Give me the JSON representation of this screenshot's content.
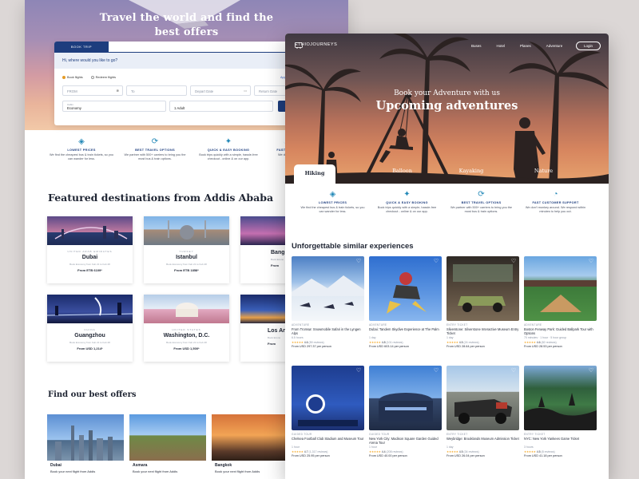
{
  "back": {
    "hero_title_1": "Travel the world  and find the",
    "hero_title_2": "best offers",
    "book_tab": "BOOK TRIP",
    "search_prompt": "Hi, where would you like to go?",
    "radio_1": "Book flights",
    "radio_2": "Redeem flights",
    "promo": "Apply promo code",
    "from_placeholder": "FROM",
    "to_placeholder": "To",
    "depart": "Depart Date",
    "return": "Return Date",
    "class_label": "Cabin",
    "class_value": "Economy",
    "pax_value": "1 Adult",
    "features": [
      {
        "title": "LOWEST PRICES",
        "desc": "We find the cheapest bus & train tickets, so you can wander for less."
      },
      {
        "title": "BEST TRAVEL OPTIONS",
        "desc": "We partner with 500+ carriers to bring you the most bus & train options."
      },
      {
        "title": "QUICK & EASY BOOKING",
        "desc": "Book trips quickly with a simple, hassle-free checkout - online & on our app."
      },
      {
        "title": "FAST CUS",
        "desc": "We don't..."
      }
    ],
    "featured_heading": "Featured destinations from Addis Ababa",
    "destinations": [
      {
        "country": "UNITED ARAB EMIRATES",
        "city": "Dubai",
        "sub": "Book Economy from Feb 21 to Feb 28",
        "price": "From ETB 6109*"
      },
      {
        "country": "TURKEY",
        "city": "Istanbul",
        "sub": "Book Economy from Feb 21 to Feb 28",
        "price": "From ETB 1858*"
      },
      {
        "country": "",
        "city": "Bang",
        "sub": "Book Econo",
        "price": "From"
      },
      {
        "country": "CHINA",
        "city": "Guangzhou",
        "sub": "Book Economy from Feb 21 to Feb 28",
        "price": "From USD 1,214*"
      },
      {
        "country": "UNITED STATES",
        "city": "Washington, D.C.",
        "sub": "Book Economy from Feb 21 to Feb 28",
        "price": "From USD 1,500*"
      },
      {
        "country": "",
        "city": "Los An",
        "sub": "Book Econo",
        "price": "From"
      }
    ],
    "offers_heading": "Find our  best offers",
    "offers": [
      {
        "name": "Dubai",
        "sub": "Book your next flight from Addis"
      },
      {
        "name": "Asmara",
        "sub": "Book your next flight from Addis"
      },
      {
        "name": "Bangkok",
        "sub": "Book your next flight from Addis"
      }
    ]
  },
  "front": {
    "brand": "ETHIOJOURNEYS",
    "nav": [
      "Buses",
      "Hotel",
      "Planes",
      "Adventure"
    ],
    "login": "Login",
    "kicker": "Book your Adventure with us",
    "title": "Upcoming adventures",
    "tabs": [
      "Hiking",
      "Balloon",
      "Kayaking",
      "Nature"
    ],
    "features": [
      {
        "title": "LOWEST PRICES",
        "desc": "We find the cheapest bus & train tickets, so you can wander for less."
      },
      {
        "title": "QUICK & EASY BOOKING",
        "desc": "Book trips quickly with a simple, hassle-free checkout - online & on our app."
      },
      {
        "title": "BEST TRAVEL OPTIONS",
        "desc": "We partner with 500+ carriers to bring you the most bus & train options."
      },
      {
        "title": "FAST CUSTOMER SUPPORT",
        "desc": "We don't monkey around. We respond within minutes to help you out."
      }
    ],
    "section": "Unforgettable similar experiences",
    "experiences": [
      {
        "cat": "ADVENTURE",
        "title": "From Tromsø: Snowmobile Safari in the Lyngen Alps",
        "dur": "6.5 hours",
        "rating": "4.6",
        "reviews": "(59 reviews)",
        "price": "From USD 297.37  per person"
      },
      {
        "cat": "ADVENTURE",
        "title": "Dubai: Tandem Skydive Experience at The Palm",
        "dur": "1 day",
        "rating": "4.8",
        "reviews": "(101 reviews)",
        "price": "From USD 603.14  per person"
      },
      {
        "cat": "ENTRY TICKET",
        "title": "Silverstone: Silverstone Interactive Museum Entry Ticket",
        "dur": "1 day",
        "rating": "4.5",
        "reviews": "(24 reviews)",
        "price": "From USD 28.64  per person"
      },
      {
        "cat": "ADVENTURE",
        "title": "Boston Fenway Park: Guided Ballpark Tour with Options",
        "dur": "70 minutes · 1 hour · 5 hour group",
        "rating": "4.6",
        "reviews": "(82 reviews)",
        "price": "From USD 28.53  per person"
      },
      {
        "cat": "GUIDED TOUR",
        "title": "Chelsea Football Club Stadium and Museum Tour",
        "dur": "1 hour",
        "rating": "4.7",
        "reviews": "(1,317 reviews)",
        "price": "From USD 25.95  per person"
      },
      {
        "cat": "GUIDED TOUR",
        "title": "New York City: Madison Square Garden Guided Arena Tour",
        "dur": "1 hour",
        "rating": "4.4",
        "reviews": "(208 reviews)",
        "price": "From USD 40.00  per person"
      },
      {
        "cat": "ENTRY TICKET",
        "title": "Weybridge: Brooklands Museum Admission Ticket",
        "dur": "1 day",
        "rating": "4.5",
        "reviews": "(34 reviews)",
        "price": "From USD 26.04  per person"
      },
      {
        "cat": "ENTRY TICKET",
        "title": "NYC: New York Yankees Game Ticket",
        "dur": "3 hours",
        "rating": "4.5",
        "reviews": "(8 reviews)",
        "price": "From USD 41.18  per person"
      }
    ],
    "stars": "★★★★★"
  },
  "colors": {
    "brand_navy": "#1d3d7e",
    "accent_teal": "#2489b8",
    "star": "#f5a623"
  }
}
